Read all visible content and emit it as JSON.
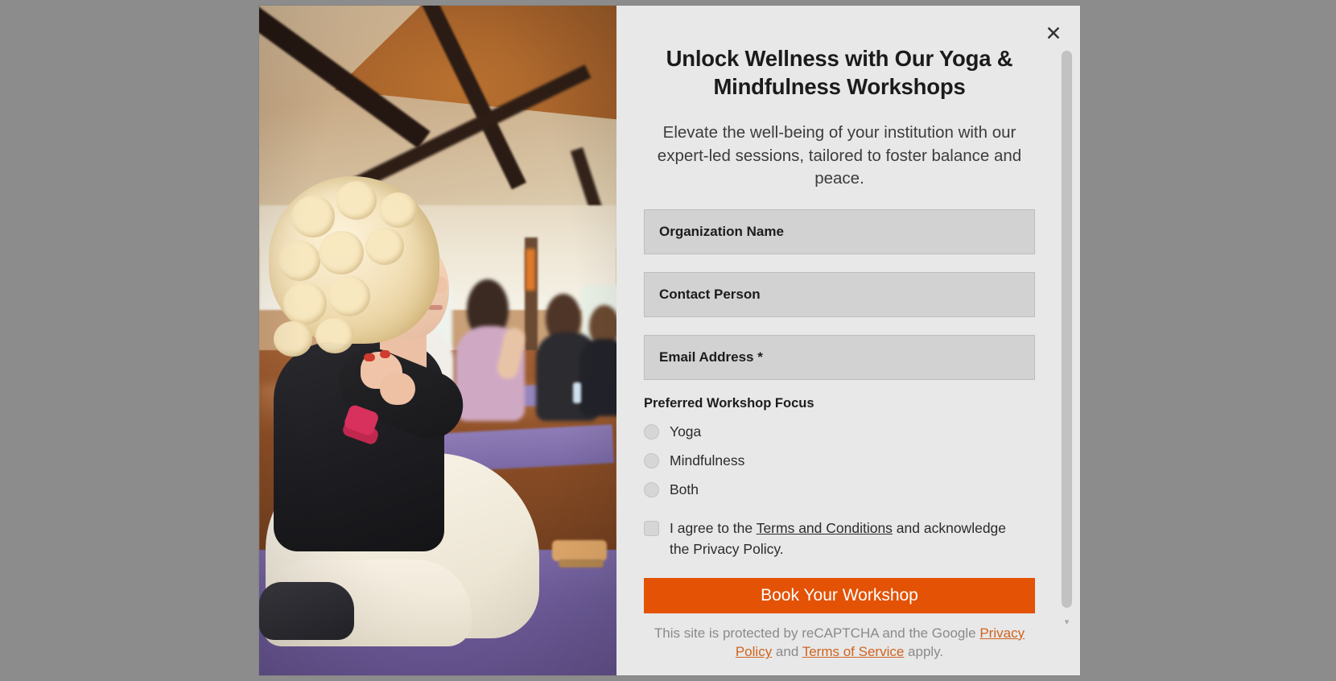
{
  "modal": {
    "close_icon": "close-icon",
    "close_glyph": "✕",
    "headline": "Unlock Wellness with Our Yoga & Mindfulness Workshops",
    "subhead": "Elevate the well-being of your institution with our expert-led sessions, tailored to foster balance and peace.",
    "accent_color": "#e35205",
    "panel_bg": "#e8e8e8",
    "field_bg": "#d2d2d2"
  },
  "hero": {
    "alt_name": "yoga-class-photo"
  },
  "form": {
    "fields": [
      {
        "name": "organization-name",
        "placeholder": "Organization Name",
        "value": ""
      },
      {
        "name": "contact-person",
        "placeholder": "Contact Person",
        "value": ""
      },
      {
        "name": "email-address",
        "placeholder": "Email Address *",
        "value": ""
      }
    ],
    "focus_label": "Preferred Workshop Focus",
    "focus_options": [
      {
        "label": "Yoga",
        "selected": false
      },
      {
        "label": "Mindfulness",
        "selected": false
      },
      {
        "label": "Both",
        "selected": false
      }
    ],
    "terms": {
      "checked": false,
      "prefix": "I agree to the ",
      "link1": "Terms and Conditions",
      "middle": " and acknowledge the Privacy Policy.",
      "full": "I agree to the Terms and Conditions and acknowledge the Privacy Policy."
    },
    "submit_label": "Book Your Workshop"
  },
  "recaptcha": {
    "prefix": "This site is protected by reCAPTCHA and the Google ",
    "link1": "Privacy Policy",
    "conjunction": " and ",
    "link2": "Terms of Service",
    "suffix": " apply."
  },
  "scrollbar": {
    "arrow_glyph": "▾"
  }
}
